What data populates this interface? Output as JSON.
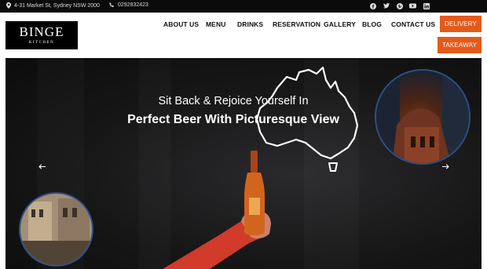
{
  "topbar": {
    "address": "4-31 Market St, Sydney NSW 2000",
    "phone": "0292832423",
    "socials": [
      "facebook-icon",
      "twitter-icon",
      "pinterest-icon",
      "youtube-icon",
      "linkedin-icon"
    ]
  },
  "logo": {
    "title": "BINGE",
    "subtitle": "KITCHEN"
  },
  "nav": {
    "items": [
      "ABOUT US",
      "MENU",
      "DRINKS",
      "RESERVATION",
      "GALLERY",
      "BLOG",
      "CONTACT US"
    ]
  },
  "buttons": {
    "delivery": "DELIVERY",
    "takeaway": "TAKEAWAY"
  },
  "hero": {
    "line1": "Sit Back & Rejoice Yourself In",
    "line2": "Perfect Beer With Picturesque View",
    "prev_icon": "arrow-left-icon",
    "next_icon": "arrow-right-icon"
  },
  "colors": {
    "accent": "#e45a1b",
    "topbar": "#0b0b0b",
    "hero": "#161617",
    "ring": "#2c4f86"
  }
}
